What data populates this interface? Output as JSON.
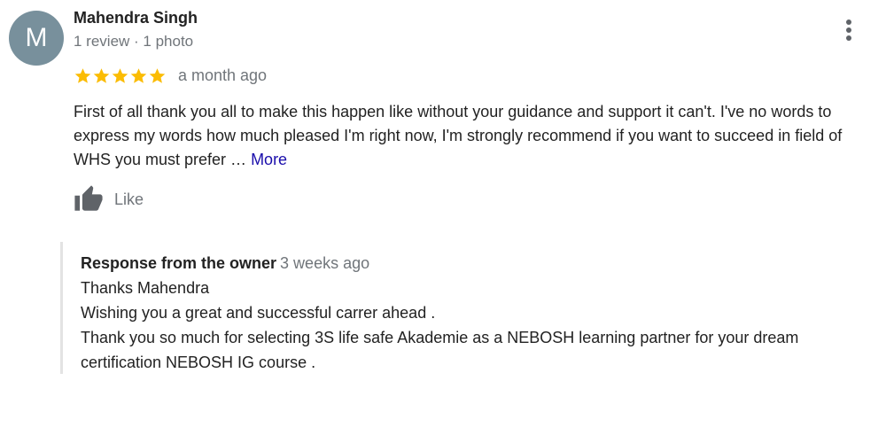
{
  "review": {
    "avatar_letter": "M",
    "avatar_color": "#78909c",
    "author_name": "Mahendra Singh",
    "author_meta": "1 review · 1 photo",
    "rating": 5,
    "star_color": "#fbbc04",
    "date": "a month ago",
    "text": "First of all thank you all to make this happen like without your guidance and support it can't. I've no words to express my words how much pleased I'm right now, I'm strongly recommend if you want to succeed in field of WHS you must prefer … ",
    "more_label": "More",
    "like_label": "Like"
  },
  "owner_response": {
    "title": "Response from the owner",
    "date": "3 weeks ago",
    "lines": [
      "Thanks Mahendra",
      "Wishing you a great and successful carrer ahead .",
      "Thank you so much for selecting 3S life safe Akademie as a NEBOSH learning partner for your dream certification NEBOSH IG course ."
    ]
  }
}
